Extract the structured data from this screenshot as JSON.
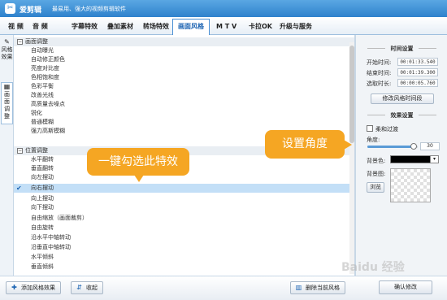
{
  "app": {
    "name": "爱剪辑",
    "slogan": "最易用、强大的视频剪辑软件",
    "logo_glyph": "✂"
  },
  "tabs": [
    {
      "label": "视 频"
    },
    {
      "label": "音 频"
    },
    {
      "label": "字幕特效"
    },
    {
      "label": "叠加素材"
    },
    {
      "label": "转场特效"
    },
    {
      "label": "画面风格",
      "active": true
    },
    {
      "label": "M T V"
    },
    {
      "label": "卡拉OK"
    },
    {
      "label": "升级与服务"
    }
  ],
  "side_tabs": [
    {
      "label": "风格效果",
      "icon": "wand-icon"
    },
    {
      "label": "画面调整",
      "icon": "panel-icon",
      "active": true
    }
  ],
  "list": {
    "groups": [
      {
        "label": "画面调整",
        "items": [
          "自动曝光",
          "自动修正颜色",
          "亮度对比度",
          "色相饱和度",
          "色彩平衡",
          "改善光线",
          "高质量去噪点",
          "锐化",
          "普通模糊",
          "强力高斯模糊"
        ]
      },
      {
        "label": "位置调整",
        "items": [
          "水平翻转",
          "垂直翻转",
          "向左摆动",
          "向右摆动",
          "向上摆动",
          "向下摆动",
          "自由缩放（画面裁剪）",
          "自由旋转",
          "沿水平中轴转动",
          "沿垂直中轴转动",
          "水平倾斜",
          "垂直倾斜"
        ]
      }
    ],
    "selected_item": "向右摆动"
  },
  "callouts": {
    "left": "一键勾选此特效",
    "right": "设置角度"
  },
  "right_panel": {
    "time_section": {
      "title": "时间设置",
      "start_label": "开始时间:",
      "start_value": "00:01:33.540",
      "end_label": "结束时间:",
      "end_value": "00:01:39.300",
      "duration_label": "选取时长:",
      "duration_value": "00:00:05.760",
      "modify_button": "修改风格时间段"
    },
    "effect_section": {
      "title": "效果设置",
      "smooth_label": "柔和过渡",
      "angle_label": "角度:",
      "angle_value": "30",
      "angle_fraction": 0.92,
      "bg_color_label": "背景色:",
      "bg_color": "#000000",
      "bg_image_label": "背景图:",
      "browse_button": "浏览"
    }
  },
  "bottom": {
    "add_button": "添加风格效果",
    "collapse_button": "收起",
    "delete_button": "删除当前风格",
    "confirm_button": "确认修改"
  },
  "watermark": "Baidu 经验",
  "colors": {
    "accent": "#2f82cc",
    "callout": "#f5a623",
    "selection": "#c3dff7"
  }
}
